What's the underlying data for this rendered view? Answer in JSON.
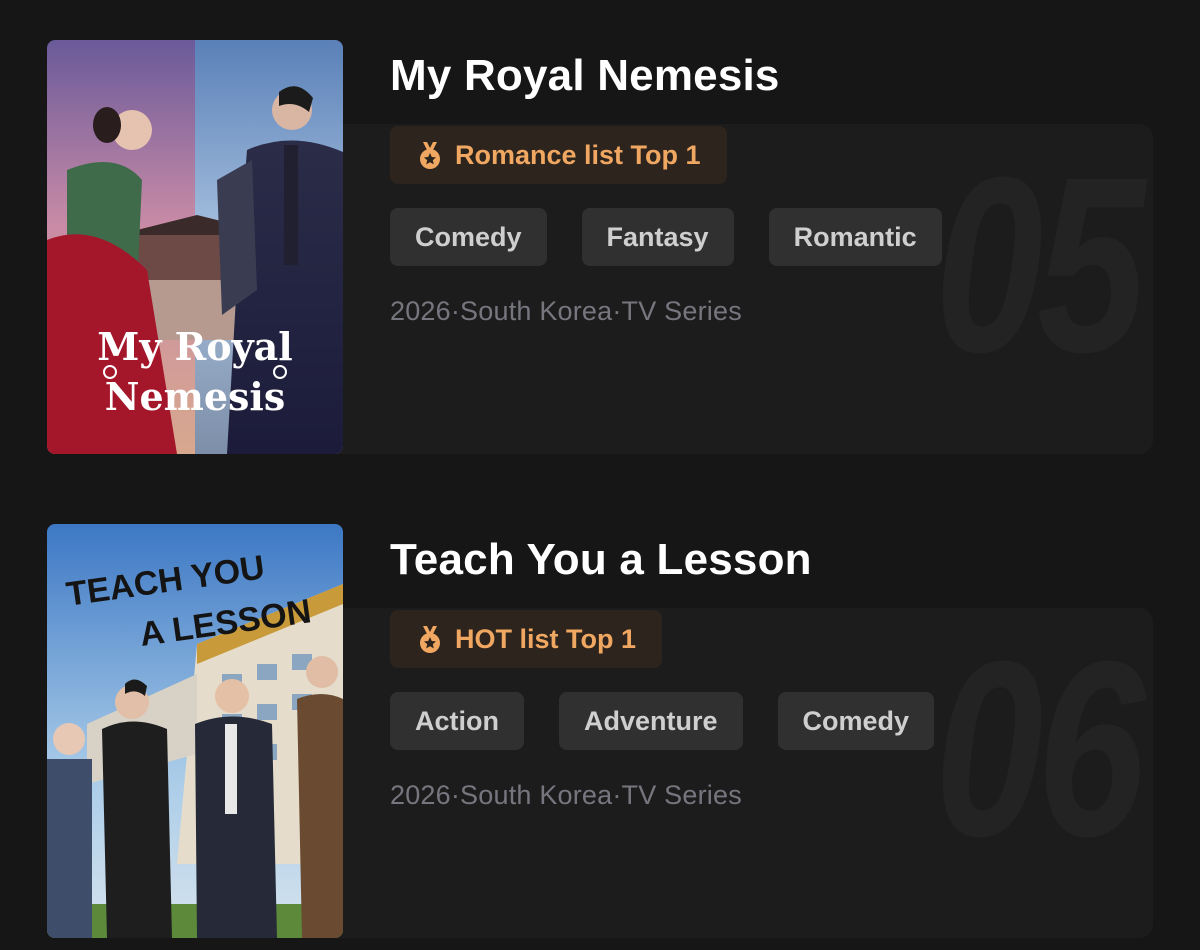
{
  "items": [
    {
      "title": "My Royal Nemesis",
      "award": "Romance list Top 1",
      "tags": [
        "Comedy",
        "Fantasy",
        "Romantic"
      ],
      "meta": "2026·South Korea·TV Series",
      "rank": "05",
      "poster": {
        "line1": "My Royal",
        "line2": "Nemesis"
      }
    },
    {
      "title": "Teach You a Lesson",
      "award": "HOT list Top 1",
      "tags": [
        "Action",
        "Adventure",
        "Comedy"
      ],
      "meta": "2026·South Korea·TV Series",
      "rank": "06",
      "poster": {
        "line1": "TEACH YOU",
        "line2": "A LESSON"
      }
    }
  ],
  "colors": {
    "background": "#161616",
    "card": "#1c1c1c",
    "award_text": "#f0a761",
    "award_bg": "#2d241d",
    "tag_bg": "#303030",
    "meta_text": "#76767f"
  },
  "icons": {
    "award": "medal-icon"
  }
}
